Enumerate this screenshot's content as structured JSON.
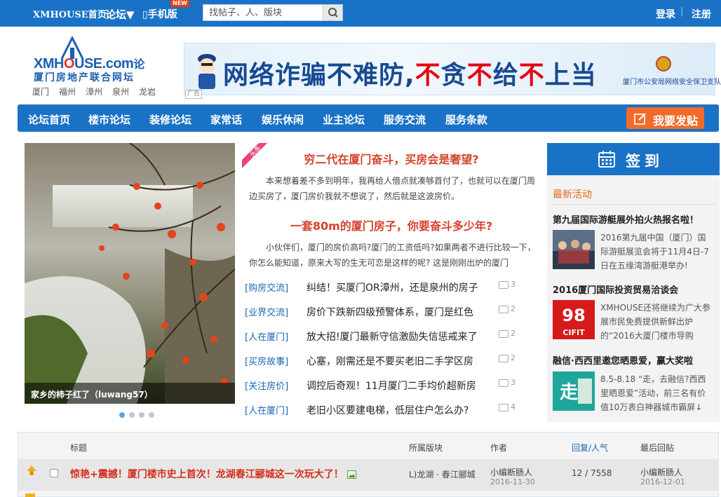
{
  "topbar": {
    "home": "XMHOUSE首页",
    "forum": "论坛▼",
    "mobile": "手机版",
    "new_badge": "NEW",
    "search_placeholder": "找帖子、人、版块",
    "login": "登录",
    "sep": "|",
    "register": "注册"
  },
  "logo": {
    "main_a": "XMH",
    "main_b": "O",
    "main_c": "USE.com",
    "main_d": "论",
    "sub": "厦门房地产联合网坛",
    "cities": [
      "厦门",
      "福州",
      "漳州",
      "泉州",
      "龙岩"
    ]
  },
  "banner": {
    "s1": "网络诈骗不难防,",
    "s2": "不",
    "s3": "贪",
    "s4": "不",
    "s5": "给",
    "s6": "不",
    "s7": "上当",
    "org": "厦门市公安局网络安全保卫支队宣",
    "ad_tag": "广告"
  },
  "nav": {
    "items": [
      "论坛首页",
      "楼市论坛",
      "装修论坛",
      "家常话",
      "娱乐休闲",
      "业主论坛",
      "服务交流",
      "服务条款"
    ],
    "post_button": "我要发贴"
  },
  "slide": {
    "caption": "家乡的柿子红了（luwang57）",
    "active_index": 0,
    "count": 4
  },
  "headline": {
    "tag": "头条",
    "title1": "穷二代在厦门奋斗，买房会是奢望?",
    "text1": "本来想着差不多到明年，我再给人借点就凑够首付了，也就可以在厦门周边买房了，厦门房价我就不想说了，然后就是这波房价。",
    "title2": "一套80m的厦门房子，你要奋斗多少年?",
    "text2": "小伙伴们，厦门的房价高吗?厦门的工资低吗?如果两者不进行比较一下，你怎么能知道，原来大写的生无可恋是这样的呢? 这是刚刚出炉的厦门"
  },
  "topics": [
    {
      "cat": "[购房交流]",
      "title": "纠结！买厦门OR漳州，还是泉州的房子",
      "comments": "3"
    },
    {
      "cat": "[业界交流]",
      "title": "房价下跌新四级预警体系，厦门是红色",
      "comments": "2"
    },
    {
      "cat": "[人在厦门]",
      "title": "放大招!厦门最新守信激励失信惩戒来了",
      "comments": "2"
    },
    {
      "cat": "[买房故事]",
      "title": "心塞，刚需还是不要买老旧二手学区房",
      "comments": "2"
    },
    {
      "cat": "[关注房价]",
      "title": "调控后奇观！11月厦门二手均价超新房",
      "comments": "3"
    },
    {
      "cat": "[人在厦门]",
      "title": "老旧小区要建电梯，低层住户怎么办?",
      "comments": "4"
    }
  ],
  "sidebar": {
    "signin": "签到",
    "latest": "最新活动",
    "acts": [
      {
        "title": "第九届国际游艇展外拍火热报名啦！",
        "desc": "2016第九届中国（厦门）国际游艇展览会将于11月4日-7日在五缘湾游艇港举办!"
      },
      {
        "title": "2016厦门国际投资贸易洽谈会",
        "desc": "XMHOUSE还将继续为广大参展市民免费提供新鲜出炉的“2016大厦门楼市导购",
        "thumb_text": "CIFIT"
      },
      {
        "title": "融信·西西里邀您晒恩爱，赢大奖啦",
        "desc": "8.5-8.18 “走，去融信?西西里晒恩爱”活动，前三名有价值10万表白神器城市霸屏↓"
      }
    ]
  },
  "table": {
    "headers": {
      "title": "标题",
      "board": "所属版块",
      "author": "作者",
      "replies": "回复/人气",
      "last": "最后回贴"
    },
    "rows": [
      {
        "title": "惊艳+震撼！厦门楼市史上首次！龙湖春江郦城这一次玩大了！",
        "board": "L)龙湖 · 春江郦城",
        "author": "小编断肠人",
        "date": "2016-11-30",
        "replies": "12 / 7558",
        "last_author": "小编断肠人",
        "last_date": "2016-12-01"
      }
    ]
  },
  "colors": {
    "brand_blue": "#1a72c6",
    "accent_orange": "#f26a2c",
    "title_red": "#d4432c"
  }
}
